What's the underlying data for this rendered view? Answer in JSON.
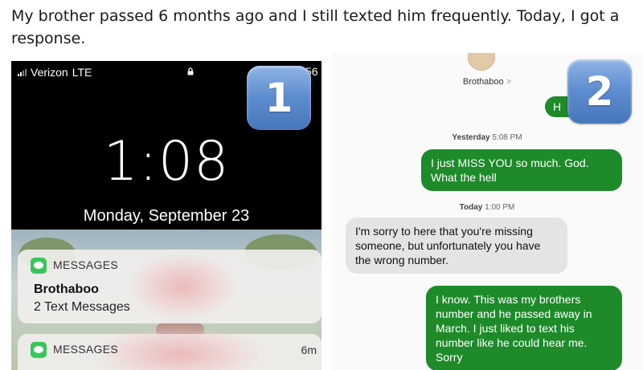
{
  "post": {
    "title": "My brother passed 6 months ago and I still texted him frequently. Today, I got a response."
  },
  "badges": {
    "first": "1",
    "second": "2"
  },
  "lockscreen": {
    "carrier": "Verizon",
    "network": "LTE",
    "status_right": "56",
    "time": "1:08",
    "date": "Monday, September 23",
    "notifications": [
      {
        "app": "MESSAGES",
        "sender": "Brothaboo",
        "body": "2 Text Messages",
        "time": ""
      },
      {
        "app": "MESSAGES",
        "sender": "",
        "body": "",
        "time": "6m"
      }
    ]
  },
  "conversation": {
    "contact": "Brothaboo",
    "contact_chevron": ">",
    "partial_bubble": "H",
    "stamps": [
      {
        "day": "Yesterday",
        "time": "5:08 PM"
      },
      {
        "day": "Today",
        "time": "1:00 PM"
      }
    ],
    "messages": [
      {
        "direction": "sent",
        "text": "I just MISS YOU so much.  God. What the hell"
      },
      {
        "direction": "received",
        "text": "I'm sorry to here that you're missing someone, but unfortunately you have the wrong number."
      },
      {
        "direction": "sent",
        "text": "I know.  This was my brothers number and he passed away in March.  I just liked to text his number like he could hear me. Sorry"
      }
    ],
    "colors": {
      "sent": "#1e8a2a",
      "received": "#e4e4e6"
    }
  }
}
